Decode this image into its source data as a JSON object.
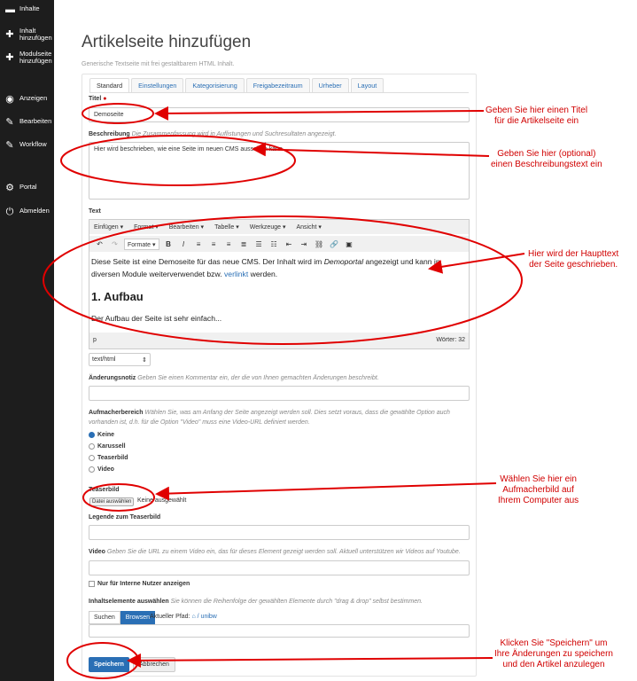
{
  "sidebar": {
    "items": [
      {
        "label": "Inhalte",
        "icon": "folder-icon"
      },
      {
        "label": "Inhalt hinzufügen",
        "icon": "plus-icon"
      },
      {
        "label": "Modulseite hinzufügen",
        "icon": "plus-icon"
      },
      {
        "label": "Anzeigen",
        "icon": "eye-icon"
      },
      {
        "label": "Bearbeiten",
        "icon": "pencil-icon"
      },
      {
        "label": "Workflow",
        "icon": "pencil-icon"
      },
      {
        "label": "Portal",
        "icon": "gears-icon"
      },
      {
        "label": "Abmelden",
        "icon": "logout-icon"
      }
    ]
  },
  "page": {
    "title": "Artikelseite hinzufügen",
    "subtitle": "Generische Textseite mit frei gestaltbarem HTML Inhalt."
  },
  "tabs": [
    "Standard",
    "Einstellungen",
    "Kategorisierung",
    "Freigabezeitraum",
    "Urheber",
    "Layout"
  ],
  "form": {
    "title_label": "Titel",
    "title_value": "Demoseite",
    "desc_label": "Beschreibung",
    "desc_hint": "Die Zusammenfassung wird in Auflistungen und Suchresultaten angezeigt.",
    "desc_value": "Hier wird beschrieben, wie eine Seite im neuen CMS aussehen kann.",
    "text_label": "Text",
    "menu": [
      "Einfügen ▾",
      "Format ▾",
      "Bearbeiten ▾",
      "Tabelle ▾",
      "Werkzeuge ▾",
      "Ansicht ▾"
    ],
    "format_select": "Formate ▾",
    "content_p1a": "Diese Seite ist eine Demoseite für das neue CMS. Der Inhalt wird im ",
    "content_p1em": "Demoportal",
    "content_p1b": " angezeigt und kann in diversen Module weiterverwendet bzw. ",
    "content_p1link": "verlinkt",
    "content_p1c": " werden.",
    "content_h": "1. Aufbau",
    "content_p2": "Der Aufbau der Seite ist sehr einfach...",
    "status_path": "p",
    "status_words": "Wörter: 32",
    "mime": "text/html",
    "note_label": "Änderungsnotiz",
    "note_hint": "Geben Sie einen Kommentar ein, der die von Ihnen gemachten Änderungen beschreibt.",
    "header_label": "Aufmacherbereich",
    "header_hint1": "Wählen Sie, was am Anfang der Seite angezeigt werden soll. Dies setzt voraus, dass die gewählte Option auch",
    "header_hint2": "vorhanden ist, d.h. für die Option \"Video\" muss eine Video-URL definiert werden.",
    "radios": [
      "Keine",
      "Karussell",
      "Teaserbild",
      "Video"
    ],
    "teaser_label": "Teaserbild",
    "file_button": "Datei auswählen",
    "file_none": "Keine ausgewählt",
    "legend_label": "Legende zum Teaserbild",
    "video_label": "Video",
    "video_hint": "Geben Sie die URL zu einem Video ein, das für dieses Element gezeigt werden soll. Aktuell unterstützen wir Videos auf Youtube.",
    "internal_label": "Nur für Interne Nutzer anzeigen",
    "elements_label": "Inhaltselemente auswählen",
    "elements_hint": "Sie können die Reihenfolge der gewählten Elemente durch \"drag & drop\" selbst bestimmen.",
    "search_tab": "Suchen",
    "browse_tab": "Browsen",
    "path_label": "Aktueller Pfad:",
    "path_value": "/ unibw",
    "save": "Speichern",
    "cancel": "Abbrechen"
  },
  "callouts": {
    "title": "Geben Sie hier einen Titel\nfür die Artikelseite ein",
    "desc": "Geben Sie hier (optional)\neinen Beschreibungstext ein",
    "text": "Hier wird der Haupttext\nder Seite geschrieben.",
    "teaser": "Wählen Sie hier ein\nAufmacherbild auf\nIhrem Computer aus",
    "save": "Klicken Sie \"Speichern\" um\nIhre Änderungen zu speichern\nund den Artikel anzulegen"
  },
  "colors": {
    "annotation": "#e00000",
    "primary": "#2a6fb5",
    "sidebar": "#1d1d1d"
  }
}
